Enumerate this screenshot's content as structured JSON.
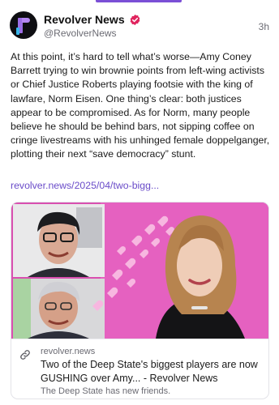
{
  "post": {
    "author": {
      "display_name": "Revolver News",
      "handle": "@RevolverNews",
      "verified": true,
      "avatar_icon": "revolver-r-logo"
    },
    "timestamp": "3h",
    "text": "At this point, it’s hard to tell what’s worse—Amy Coney Barrett trying to win brownie points from left-wing activists or Chief Justice Roberts playing footsie with the king of lawfare, Norm Eisen. One thing’s clear: both justices appear to be compromised. As for Norm, many people believe he should be behind bars, not sipping coffee on cringe livestreams with his unhinged female doppelganger, plotting their next “save democracy” stunt.",
    "link_text": "revolver.news/2025/04/two-bigg...",
    "link_card": {
      "domain": "revolver.news",
      "title": "Two of the Deep State's biggest players are now GUSHING over Amy... - Revolver News",
      "description": "The Deep State has new friends.",
      "icon": "link-chain-icon"
    }
  },
  "colors": {
    "accent": "#7b4fd6",
    "link": "#6a4cc9",
    "verified_badge": "#e0245e",
    "image_background": "#d94fb0"
  }
}
